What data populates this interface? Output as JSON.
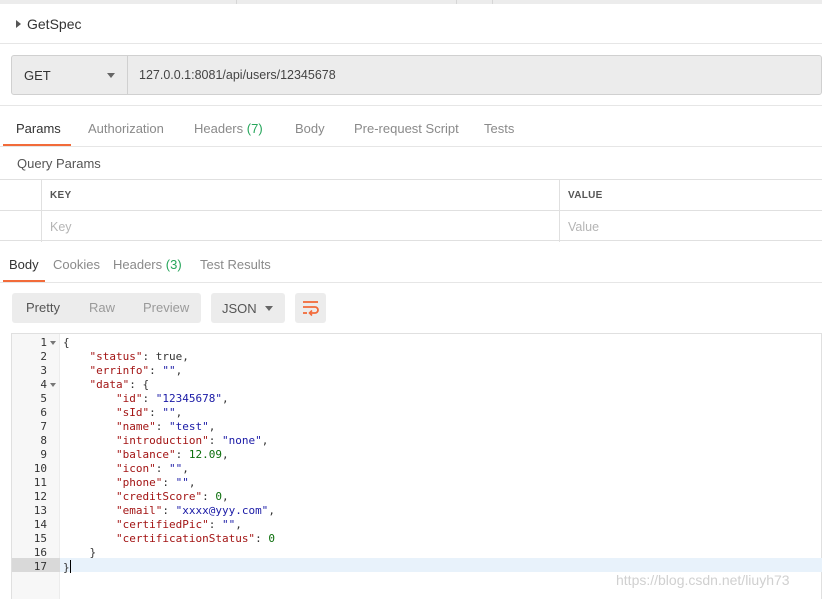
{
  "request": {
    "name": "GetSpec",
    "method": "GET",
    "url": "127.0.0.1:8081/api/users/12345678"
  },
  "request_tabs": [
    {
      "label": "Params",
      "count": ""
    },
    {
      "label": "Authorization",
      "count": ""
    },
    {
      "label": "Headers",
      "count": "(7)"
    },
    {
      "label": "Body",
      "count": ""
    },
    {
      "label": "Pre-request Script",
      "count": ""
    },
    {
      "label": "Tests",
      "count": ""
    }
  ],
  "query_params": {
    "title": "Query Params",
    "key_header": "KEY",
    "value_header": "VALUE",
    "key_placeholder": "Key",
    "value_placeholder": "Value"
  },
  "response_tabs": [
    {
      "label": "Body",
      "count": ""
    },
    {
      "label": "Cookies",
      "count": ""
    },
    {
      "label": "Headers",
      "count": "(3)"
    },
    {
      "label": "Test Results",
      "count": ""
    }
  ],
  "view_modes": [
    "Pretty",
    "Raw",
    "Preview"
  ],
  "format": "JSON",
  "colors": {
    "accent": "#f26b3a",
    "count_green": "#26a65b",
    "json_key": "#a31515",
    "json_string": "#1a1aa6",
    "json_number": "#0b6e0b"
  },
  "code_lines": [
    {
      "n": "1",
      "fold": true,
      "t": [
        [
          "p",
          "{"
        ]
      ]
    },
    {
      "n": "2",
      "fold": false,
      "t": [
        [
          "p",
          "    "
        ],
        [
          "k",
          "\"status\""
        ],
        [
          "p",
          ": true,"
        ]
      ]
    },
    {
      "n": "3",
      "fold": false,
      "t": [
        [
          "p",
          "    "
        ],
        [
          "k",
          "\"errinfo\""
        ],
        [
          "p",
          ": "
        ],
        [
          "s",
          "\"\""
        ],
        [
          "p",
          ","
        ]
      ]
    },
    {
      "n": "4",
      "fold": true,
      "t": [
        [
          "p",
          "    "
        ],
        [
          "k",
          "\"data\""
        ],
        [
          "p",
          ": {"
        ]
      ]
    },
    {
      "n": "5",
      "fold": false,
      "t": [
        [
          "p",
          "        "
        ],
        [
          "k",
          "\"id\""
        ],
        [
          "p",
          ": "
        ],
        [
          "s",
          "\"12345678\""
        ],
        [
          "p",
          ","
        ]
      ]
    },
    {
      "n": "6",
      "fold": false,
      "t": [
        [
          "p",
          "        "
        ],
        [
          "k",
          "\"sId\""
        ],
        [
          "p",
          ": "
        ],
        [
          "s",
          "\"\""
        ],
        [
          "p",
          ","
        ]
      ]
    },
    {
      "n": "7",
      "fold": false,
      "t": [
        [
          "p",
          "        "
        ],
        [
          "k",
          "\"name\""
        ],
        [
          "p",
          ": "
        ],
        [
          "s",
          "\"test\""
        ],
        [
          "p",
          ","
        ]
      ]
    },
    {
      "n": "8",
      "fold": false,
      "t": [
        [
          "p",
          "        "
        ],
        [
          "k",
          "\"introduction\""
        ],
        [
          "p",
          ": "
        ],
        [
          "s",
          "\"none\""
        ],
        [
          "p",
          ","
        ]
      ]
    },
    {
      "n": "9",
      "fold": false,
      "t": [
        [
          "p",
          "        "
        ],
        [
          "k",
          "\"balance\""
        ],
        [
          "p",
          ": "
        ],
        [
          "n",
          "12.09"
        ],
        [
          "p",
          ","
        ]
      ]
    },
    {
      "n": "10",
      "fold": false,
      "t": [
        [
          "p",
          "        "
        ],
        [
          "k",
          "\"icon\""
        ],
        [
          "p",
          ": "
        ],
        [
          "s",
          "\"\""
        ],
        [
          "p",
          ","
        ]
      ]
    },
    {
      "n": "11",
      "fold": false,
      "t": [
        [
          "p",
          "        "
        ],
        [
          "k",
          "\"phone\""
        ],
        [
          "p",
          ": "
        ],
        [
          "s",
          "\"\""
        ],
        [
          "p",
          ","
        ]
      ]
    },
    {
      "n": "12",
      "fold": false,
      "t": [
        [
          "p",
          "        "
        ],
        [
          "k",
          "\"creditScore\""
        ],
        [
          "p",
          ": "
        ],
        [
          "n",
          "0"
        ],
        [
          "p",
          ","
        ]
      ]
    },
    {
      "n": "13",
      "fold": false,
      "t": [
        [
          "p",
          "        "
        ],
        [
          "k",
          "\"email\""
        ],
        [
          "p",
          ": "
        ],
        [
          "s",
          "\"xxxx@yyy.com\""
        ],
        [
          "p",
          ","
        ]
      ]
    },
    {
      "n": "14",
      "fold": false,
      "t": [
        [
          "p",
          "        "
        ],
        [
          "k",
          "\"certifiedPic\""
        ],
        [
          "p",
          ": "
        ],
        [
          "s",
          "\"\""
        ],
        [
          "p",
          ","
        ]
      ]
    },
    {
      "n": "15",
      "fold": false,
      "t": [
        [
          "p",
          "        "
        ],
        [
          "k",
          "\"certificationStatus\""
        ],
        [
          "p",
          ": "
        ],
        [
          "n",
          "0"
        ]
      ]
    },
    {
      "n": "16",
      "fold": false,
      "t": [
        [
          "p",
          "    }"
        ]
      ]
    },
    {
      "n": "17",
      "fold": false,
      "t": [
        [
          "p",
          "}"
        ]
      ]
    }
  ],
  "watermark": "https://blog.csdn.net/liuyh73"
}
